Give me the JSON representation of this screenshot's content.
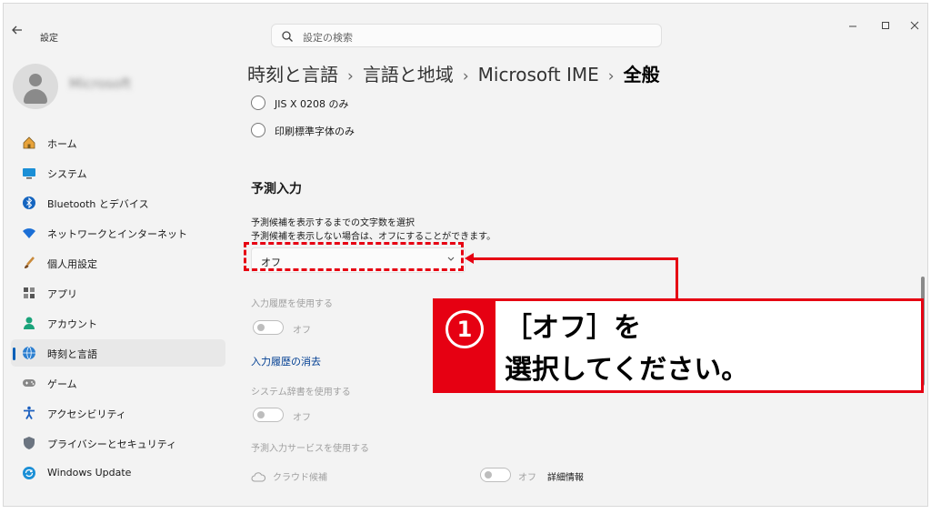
{
  "window": {
    "app_title": "設定",
    "search_placeholder": "設定の検索"
  },
  "account": {
    "name": "Microsoft"
  },
  "sidebar": {
    "items": [
      {
        "label": "ホーム",
        "icon": "home-icon"
      },
      {
        "label": "システム",
        "icon": "monitor-icon"
      },
      {
        "label": "Bluetooth とデバイス",
        "icon": "bluetooth-icon"
      },
      {
        "label": "ネットワークとインターネット",
        "icon": "wifi-icon"
      },
      {
        "label": "個人用設定",
        "icon": "brush-icon"
      },
      {
        "label": "アプリ",
        "icon": "apps-icon"
      },
      {
        "label": "アカウント",
        "icon": "person-icon"
      },
      {
        "label": "時刻と言語",
        "icon": "globe-clock-icon",
        "active": true
      },
      {
        "label": "ゲーム",
        "icon": "gamepad-icon"
      },
      {
        "label": "アクセシビリティ",
        "icon": "accessibility-icon"
      },
      {
        "label": "プライバシーとセキュリティ",
        "icon": "shield-icon"
      },
      {
        "label": "Windows Update",
        "icon": "update-icon"
      }
    ]
  },
  "breadcrumb": {
    "items": [
      "時刻と言語",
      "言語と地域",
      "Microsoft IME"
    ],
    "current": "全般"
  },
  "content": {
    "radio_jis": "JIS X 0208 のみ",
    "radio_print": "印刷標準字体のみ",
    "section_title": "予測入力",
    "desc1": "予測候補を表示するまでの文字数を選択",
    "desc2": "予測候補を表示しない場合は、オフにすることができます。",
    "dropdown_value": "オフ",
    "history_label": "入力履歴を使用する",
    "history_toggle": "オフ",
    "clear_history_link": "入力履歴の消去",
    "sysdict_label": "システム辞書を使用する",
    "sysdict_toggle": "オフ",
    "service_label": "予測入力サービスを使用する",
    "cloud_label": "クラウド候補",
    "cloud_toggle": "オフ",
    "details_label": "詳細情報"
  },
  "annotation": {
    "number": "①",
    "line1": "［オフ］を",
    "line2": "選択してください。",
    "color": "#e60012"
  }
}
